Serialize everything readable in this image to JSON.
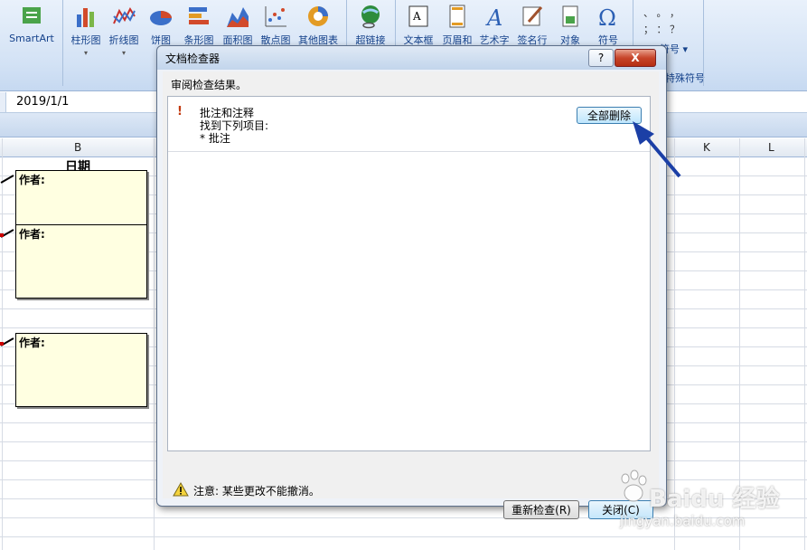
{
  "ribbon": {
    "buttons": [
      {
        "label": "SmartArt"
      },
      {
        "label": "柱形图"
      },
      {
        "label": "折线图"
      },
      {
        "label": "饼图"
      },
      {
        "label": "条形图"
      },
      {
        "label": "面积图"
      },
      {
        "label": "散点图"
      },
      {
        "label": "其他图表"
      },
      {
        "label": "超链接"
      },
      {
        "label": "文本框"
      },
      {
        "label": "页眉和"
      },
      {
        "label": "艺术字"
      },
      {
        "label": "签名行"
      },
      {
        "label": "对象"
      },
      {
        "label": "符号"
      }
    ],
    "symbol_dropdown": "符号",
    "symbol_group_label": "特殊符号",
    "symbols_row1": "、  。  ，",
    "symbols_row2": "；  ：  ？"
  },
  "formula_bar": {
    "value": "2019/1/1"
  },
  "sheet": {
    "column_headers": [
      "B",
      "K",
      "L"
    ],
    "cell_b1": "日期",
    "note_author_label": "作者:"
  },
  "dialog": {
    "title": "文档检查器",
    "help": "?",
    "close_x": "X",
    "results_heading": "审阅检查结果。",
    "item": {
      "icon": "!",
      "title": "批注和注释",
      "found": "找到下列项目:",
      "bullet": "* 批注"
    },
    "remove_all_label": "全部删除",
    "note": "注意: 某些更改不能撤消。",
    "recheck_label": "重新检查(R)",
    "close_label": "关闭(C)"
  },
  "watermark": {
    "text": "Baidu 经验",
    "url": "jingyan.baidu.com"
  },
  "colors": {
    "ribbon_text": "#15428b",
    "note_fill": "#ffffe1",
    "arrow_blue": "#1b3fa6",
    "close_red": "#c7452a"
  }
}
